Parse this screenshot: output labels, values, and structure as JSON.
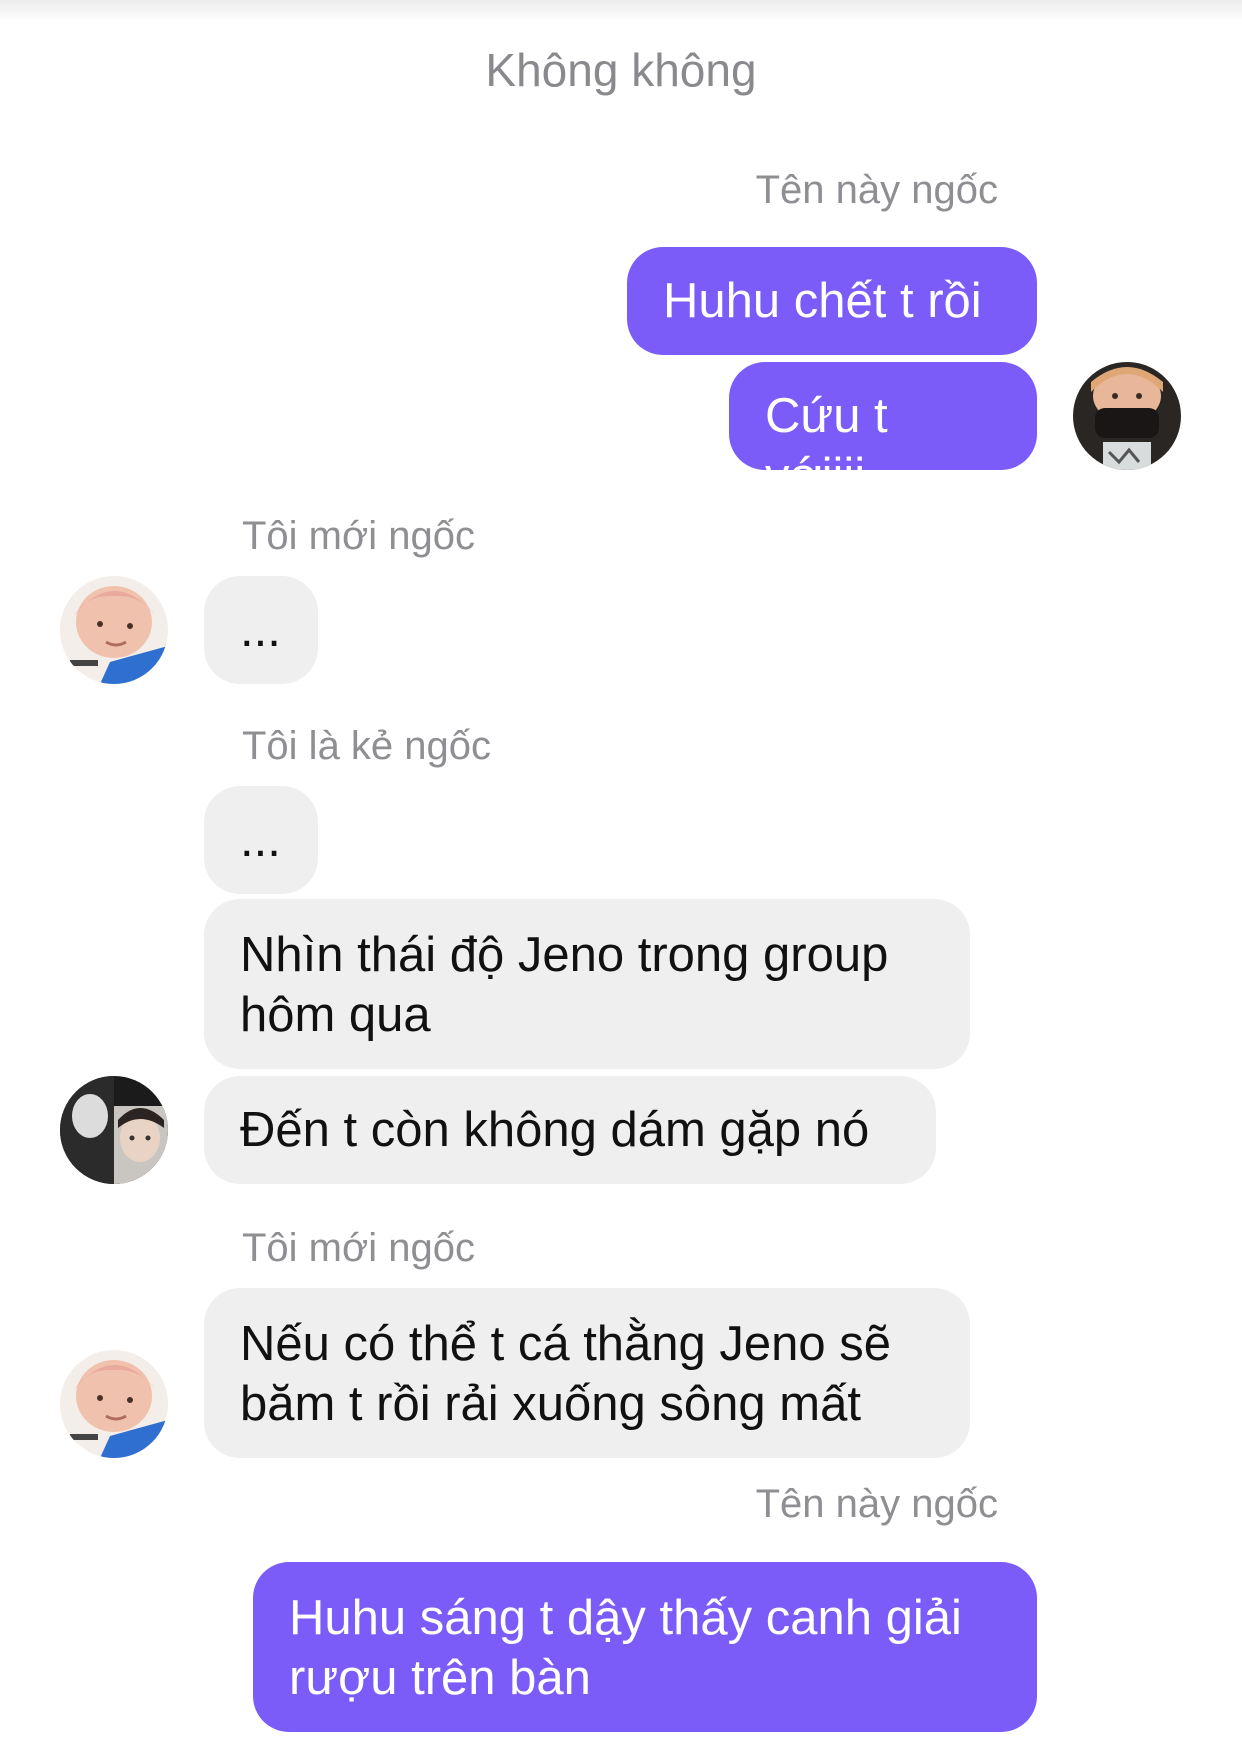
{
  "chat": {
    "title": "Không không"
  },
  "messages": {
    "m1": {
      "sender": "Tên này ngốc",
      "text": "Huhu chết t rồi"
    },
    "m2": {
      "text": "Cứu t vớiiii"
    },
    "m3": {
      "sender": "Tôi mới ngốc",
      "text": "..."
    },
    "m4": {
      "sender": "Tôi là kẻ ngốc",
      "text": "..."
    },
    "m5": {
      "text": "Nhìn thái độ Jeno trong group hôm qua"
    },
    "m6": {
      "text": "Đến t còn không dám gặp nó"
    },
    "m7": {
      "sender": "Tôi mới ngốc",
      "text": "Nếu có thể t cá thằng Jeno sẽ băm t rồi rải xuống sông mất"
    },
    "m8": {
      "sender": "Tên này ngốc",
      "text": "Huhu sáng t dậy thấy canh giải rượu trên bàn"
    }
  },
  "colors": {
    "outgoing_bubble": "#7b5cf8",
    "incoming_bubble": "#efeff0",
    "name_text": "#8e8e93"
  },
  "icons": {
    "avatar_me": "user-avatar-photo",
    "avatar_toi_moi_ngoc": "user-avatar-photo",
    "avatar_toi_la_ke_ngoc": "user-avatar-photo"
  }
}
